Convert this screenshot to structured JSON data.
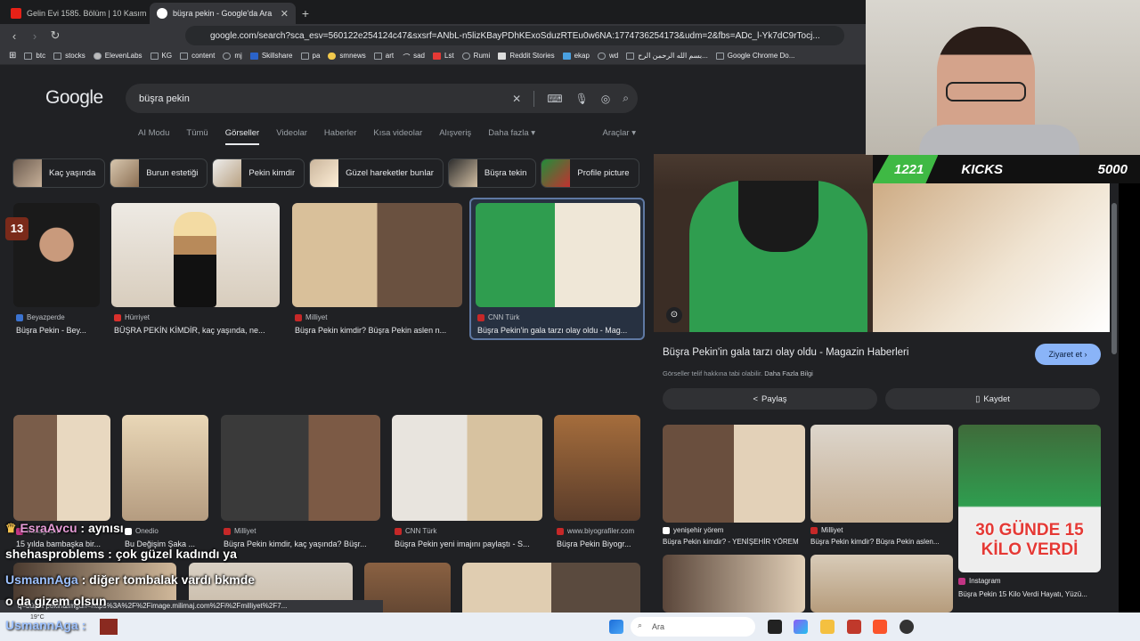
{
  "tabs": [
    {
      "label": "Gelin Evi 1585. Bölüm | 10 Kasım",
      "active": false
    },
    {
      "label": "büşra pekin - Google'da Ara",
      "active": true
    }
  ],
  "url": "google.com/search?sca_esv=560122e254124c47&sxsrf=ANbL-n5lizKBayPDhKExoSduzRTEu0w6NA:1774736254173&udm=2&fbs=ADc_l-Yk7dC9rTocj...",
  "bookmarks": [
    "btc",
    "stocks",
    "ElevenLabs",
    "KG",
    "content",
    "mj",
    "Skillshare",
    "pa",
    "smnews",
    "art",
    "sad",
    "Lst",
    "Rumi",
    "Reddit Stories",
    "ekap",
    "wd",
    "بسم الله الرحمن الرح...",
    "Google Chrome Do..."
  ],
  "google": {
    "logo": "Google",
    "query": "büşra pekin"
  },
  "nav": {
    "items": [
      "AI Modu",
      "Tümü",
      "Görseller",
      "Videolar",
      "Haberler",
      "Kısa videolar",
      "Alışveriş",
      "Daha fazla ▾"
    ],
    "tools": "Araçlar ▾"
  },
  "chips": [
    "Kaç yaşında",
    "Burun estetiği",
    "Pekin kimdir",
    "Güzel hareketler bunlar",
    "Büşra tekin",
    "Profile picture"
  ],
  "results": [
    {
      "source": "Beyazperde",
      "caption": "Büşra Pekin - Bey..."
    },
    {
      "source": "Hürriyet",
      "caption": "BÜŞRA PEKİN KİMDİR, kaç yaşında, ne..."
    },
    {
      "source": "Milliyet",
      "caption": "Büşra Pekin kimdir? Büşra Pekin aslen n..."
    },
    {
      "source": "CNN Türk",
      "caption": "Büşra Pekin'in gala tarzı olay oldu - Mag..."
    },
    {
      "source": "Instagram",
      "caption": "15 yılda bambaşka bir..."
    },
    {
      "source": "Onedio",
      "caption": "Bu Değişim Şaka ..."
    },
    {
      "source": "Milliyet",
      "caption": "Büşra Pekin kimdir, kaç yaşında? Büşr..."
    },
    {
      "source": "CNN Türk",
      "caption": "Büşra Pekin yeni imajını paylaştı - S..."
    },
    {
      "source": "www.biyografiler.com",
      "caption": "Büşra Pekin Biyogr..."
    }
  ],
  "panel": {
    "title": "Büşra Pekin'in gala tarzı olay oldu - Magazin Haberleri",
    "visit": "Ziyaret et ›",
    "license": "Görseller telif hakkına tabi olabilir.",
    "license_link": "Daha Fazla Bilgi",
    "share": "Paylaş",
    "save": "Kaydet",
    "related": [
      {
        "source": "yenişehir yörem",
        "caption": "Büşra Pekin kimdir? - YENİŞEHİR YÖREM"
      },
      {
        "source": "Milliyet",
        "caption": "Büşra Pekin kimdir? Büşra Pekin aslen..."
      },
      {
        "source": "Instagram",
        "caption": "Büşra Pekin 15 Kilo Verdi Hayatı, Yüzü..."
      }
    ],
    "overlay_text": "30 GÜNDE 15 KİLO VERDİ"
  },
  "stream": {
    "kicks_count": "1221",
    "kicks_label": "KICKS",
    "kicks_goal": "5000",
    "chat": [
      {
        "user": "EsraAvcu",
        "msg": "aynısı"
      },
      {
        "user": "shehasproblems",
        "msg": "çok güzel kadındı ya"
      },
      {
        "user": "UsmannAga",
        "msg": "diğer tombalak vardı bkmde"
      },
      {
        "user": "",
        "msg": "o da gizem olsun"
      },
      {
        "user": "UsmannAga",
        "msg": ""
      }
    ],
    "badge_num": "13"
  },
  "status_url": "q=büşra pekin&imgurl=https%3A%2F%2Fimage.milimaj.com%2Fi%2Fmilliyet%2F7...",
  "taskbar": {
    "search": "Ara",
    "weather": "19°C"
  }
}
